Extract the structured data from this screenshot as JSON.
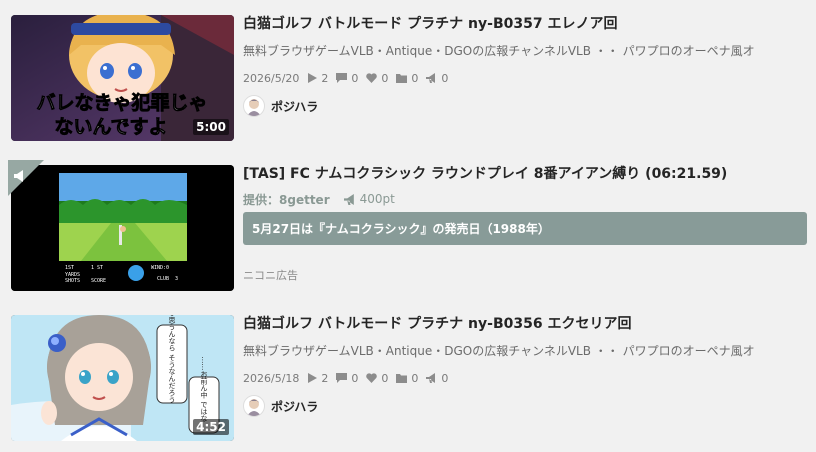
{
  "items": [
    {
      "type": "video",
      "title": "白猫ゴルフ バトルモード プラチナ ny-B0357 エレノア回",
      "description": "無料ブラウザゲームVLB・Antique・DGOの広報チャンネルVLB ・・ パワプロのオーペナ風オ",
      "date": "2026/5/20",
      "views": "2",
      "comments": "0",
      "likes": "0",
      "mylists": "0",
      "ad_points": "0",
      "owner": "ポジハラ",
      "duration": "5:00",
      "thumb_caption_line1": "バレなきゃ犯罪じゃ",
      "thumb_caption_line2": "ないんですよ"
    },
    {
      "type": "nicoad",
      "title": "[TAS] FC ナムコクラシック ラウンドプレイ 8番アイアン縛り (06:21.59)",
      "provider": "提供：8getter",
      "points": "400pt",
      "message": "5月27日は『ナムコクラシック』の発売日（1988年）",
      "ad_label": "ニコニ広告",
      "game_hud": [
        "1ST",
        "1 ST",
        "WIND:0",
        "YARDS",
        "SHOTS",
        "SCORE",
        "CLUB",
        "3"
      ]
    },
    {
      "type": "video",
      "title": "白猫ゴルフ バトルモード プラチナ ny-B0356 エクセリア回",
      "description": "無料ブラウザゲームVLB・Antique・DGOの広報チャンネルVLB ・・ パワプロのオーペナ風オ",
      "date": "2026/5/18",
      "views": "2",
      "comments": "0",
      "likes": "0",
      "mylists": "0",
      "ad_points": "0",
      "owner": "ポジハラ",
      "duration": "4:52",
      "thumb_bubble_1": "お前が そう思うんなら そうなんだろう",
      "thumb_bubble_2": "……お前ん中 ではな"
    }
  ],
  "colors": {
    "background": "#f1f1f1",
    "ad_message_bg": "#889b98",
    "provider_text": "#8a9994",
    "meta_text": "#7a7a7a"
  },
  "icons": [
    "play-icon",
    "comment-icon",
    "heart-icon",
    "folder-icon",
    "megaphone-icon"
  ]
}
